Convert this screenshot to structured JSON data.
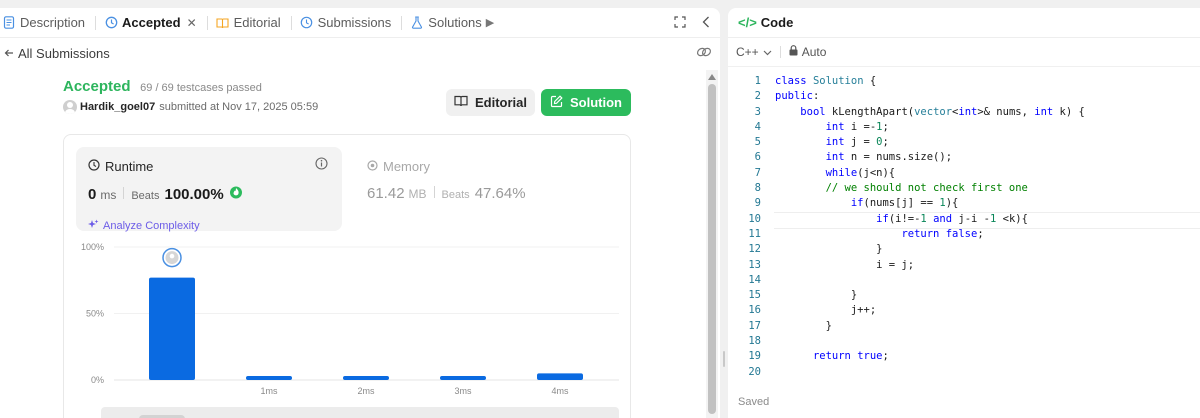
{
  "tabs": [
    {
      "label": "Description",
      "icon": "description-icon",
      "active": false
    },
    {
      "label": "Accepted",
      "icon": "history-icon",
      "active": true
    },
    {
      "label": "Editorial",
      "icon": "book-icon",
      "active": false
    },
    {
      "label": "Submissions",
      "icon": "history-icon",
      "active": false
    },
    {
      "label": "Solutions",
      "icon": "flask-icon",
      "active": false
    }
  ],
  "back_link": "All Submissions",
  "submission": {
    "status": "Accepted",
    "testcases": "69 / 69 testcases passed",
    "username": "Hardik_goel07",
    "submitted_at": "submitted at Nov 17, 2025 05:59"
  },
  "buttons": {
    "editorial": "Editorial",
    "solution": "Solution"
  },
  "runtime": {
    "title": "Runtime",
    "value": "0",
    "unit": "ms",
    "beats_label": "Beats",
    "beats": "100.00%",
    "analyze": "Analyze Complexity"
  },
  "memory": {
    "title": "Memory",
    "value": "61.42",
    "unit": "MB",
    "beats_label": "Beats",
    "beats": "47.64%"
  },
  "chart_data": {
    "type": "bar",
    "categories": [
      "",
      "1ms",
      "2ms",
      "3ms",
      "4ms"
    ],
    "values": [
      77,
      3,
      3,
      3,
      5
    ],
    "highlight_index": 0,
    "ytick_labels": [
      "100%",
      "50%",
      "0%"
    ],
    "ylim": [
      0,
      100
    ],
    "color": "#0a6ae1"
  },
  "code": {
    "title": "Code",
    "language": "C++",
    "mode": "Auto",
    "saved_label": "Saved",
    "current_line": 10,
    "lines": [
      "class Solution {",
      "public:",
      "    bool kLengthApart(vector<int>& nums, int k) {",
      "        int i =-1;",
      "        int j = 0;",
      "        int n = nums.size();",
      "        while(j<n){",
      "        // we should not check first one",
      "            if(nums[j] == 1){",
      "                if(i!=-1 and j-i -1 <k){",
      "                    return false;",
      "                }",
      "                i = j;",
      "",
      "            }",
      "            j++;",
      "        }",
      "",
      "      return true;",
      ""
    ]
  },
  "colors": {
    "accepted": "#2db55d",
    "solution_button": "#2cbb5d",
    "bar": "#0a6ae1",
    "analyze": "#6c5ce7"
  }
}
